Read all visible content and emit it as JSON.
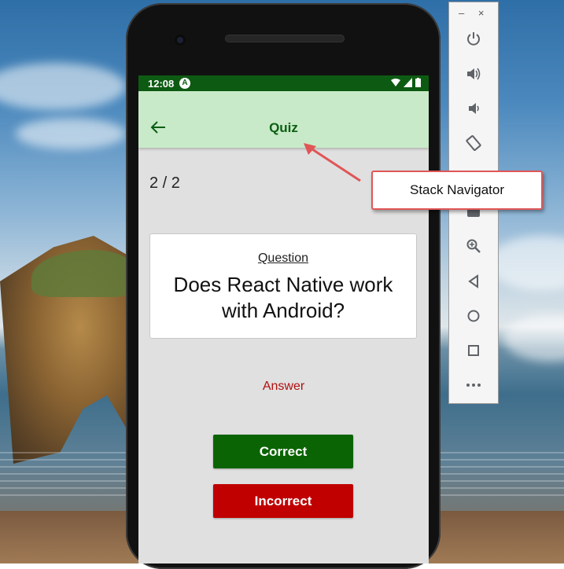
{
  "statusbar": {
    "time": "12:08",
    "badge": "A"
  },
  "appbar": {
    "title": "Quiz"
  },
  "quiz": {
    "counter": "2 / 2",
    "question_label": "Question",
    "question_text": "Does React Native work with Android?",
    "answer_link": "Answer",
    "correct_label": "Correct",
    "incorrect_label": "Incorrect"
  },
  "emulator": {
    "window_controls": [
      "–",
      "×"
    ],
    "icons": [
      "power-icon",
      "volume-up-icon",
      "volume-down-icon",
      "rotate-icon",
      "camera-icon",
      "zoom-icon",
      "back-icon",
      "home-icon",
      "overview-icon",
      "more-icon"
    ]
  },
  "callout": {
    "text": "Stack Navigator"
  },
  "colors": {
    "statusbar": "#0d5b13",
    "appbar": "#c9eac9",
    "title": "#0b5e12",
    "correct": "#0b6404",
    "incorrect": "#c00000",
    "answer": "#b11010",
    "callout_border": "#e05656"
  }
}
